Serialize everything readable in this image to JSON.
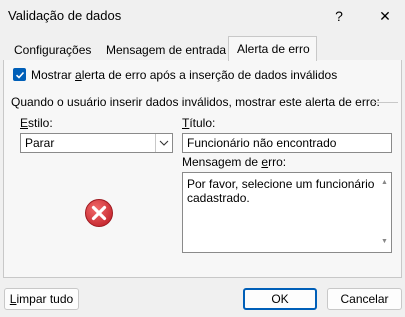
{
  "window": {
    "title": "Validação de dados",
    "help_glyph": "?",
    "close_glyph": "✕"
  },
  "tabs": [
    {
      "label": "Configurações",
      "active": false
    },
    {
      "label": "Mensagem de entrada",
      "active": false
    },
    {
      "label": "Alerta de erro",
      "active": true
    }
  ],
  "error_alert": {
    "show_alert_checked": true,
    "show_alert_pre": "Mostrar ",
    "show_alert_key": "a",
    "show_alert_post": "lerta de erro após a inserção de dados inválidos",
    "group_label": "Quando o usuário inserir dados inválidos, mostrar este alerta de erro:",
    "style_label_key": "E",
    "style_label_rest": "stilo:",
    "style_value": "Parar",
    "title_label_key": "T",
    "title_label_rest": "ítulo:",
    "title_value": "Funcionário não encontrado",
    "message_label_pre": "Mensagem de ",
    "message_label_key": "e",
    "message_label_post": "rro:",
    "message_value": "Por favor, selecione um funcionário cadastrado.",
    "icon": "error-stop-icon",
    "icon_color": "#d13438"
  },
  "buttons": {
    "clear_key": "L",
    "clear_rest": "impar tudo",
    "ok": "OK",
    "cancel": "Cancelar"
  },
  "colors": {
    "accent": "#005fb8",
    "dialog_bg": "#f0f0f0"
  }
}
